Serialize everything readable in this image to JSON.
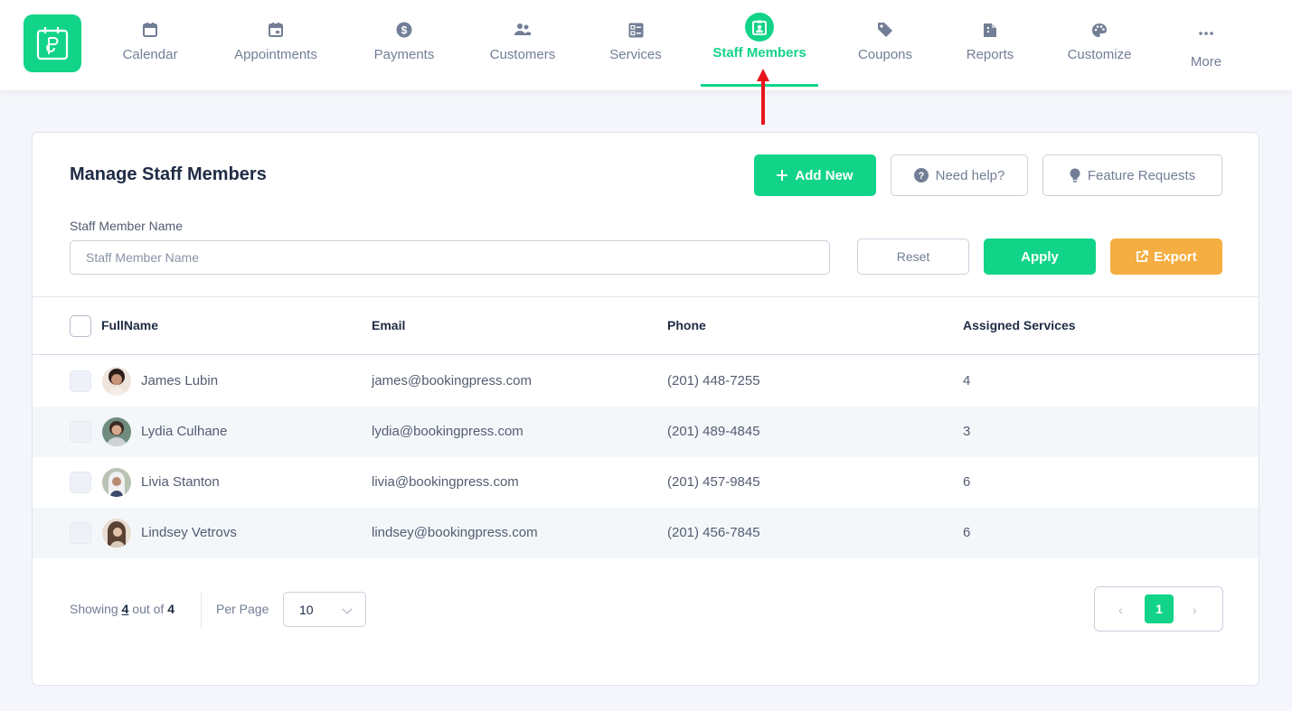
{
  "colors": {
    "brand": "#12d488",
    "export": "#f5ae41",
    "annotation_arrow": "#e8141b"
  },
  "nav": {
    "items": [
      {
        "label": "Calendar",
        "icon": "calendar-icon"
      },
      {
        "label": "Appointments",
        "icon": "calendar-event-icon"
      },
      {
        "label": "Payments",
        "icon": "dollar-circle-icon"
      },
      {
        "label": "Customers",
        "icon": "users-icon"
      },
      {
        "label": "Services",
        "icon": "list-box-icon"
      },
      {
        "label": "Staff Members",
        "icon": "id-badge-icon",
        "active": true
      },
      {
        "label": "Coupons",
        "icon": "tag-icon"
      },
      {
        "label": "Reports",
        "icon": "file-report-icon"
      },
      {
        "label": "Customize",
        "icon": "palette-icon"
      },
      {
        "label": "More",
        "icon": "more-dots-icon"
      }
    ]
  },
  "page": {
    "title": "Manage Staff Members",
    "add_new_label": "Add New",
    "need_help_label": "Need help?",
    "feature_requests_label": "Feature Requests"
  },
  "filter": {
    "label": "Staff Member Name",
    "placeholder": "Staff Member Name",
    "value": "",
    "reset_label": "Reset",
    "apply_label": "Apply",
    "export_label": "Export"
  },
  "table": {
    "columns": [
      "FullName",
      "Email",
      "Phone",
      "Assigned Services"
    ],
    "rows": [
      {
        "name": "James Lubin",
        "email": "james@bookingpress.com",
        "phone": "(201) 448-7255",
        "services": "4"
      },
      {
        "name": "Lydia Culhane",
        "email": "lydia@bookingpress.com",
        "phone": "(201) 489-4845",
        "services": "3"
      },
      {
        "name": "Livia Stanton",
        "email": "livia@bookingpress.com",
        "phone": "(201) 457-9845",
        "services": "6"
      },
      {
        "name": "Lindsey Vetrovs",
        "email": "lindsey@bookingpress.com",
        "phone": "(201) 456-7845",
        "services": "6"
      }
    ]
  },
  "footer": {
    "showing_prefix": "Showing",
    "showing_count": "4",
    "showing_mid": "out of",
    "total": "4",
    "per_page_label": "Per Page",
    "per_page_value": "10",
    "prev": "‹",
    "next": "›",
    "current_page": "1"
  }
}
